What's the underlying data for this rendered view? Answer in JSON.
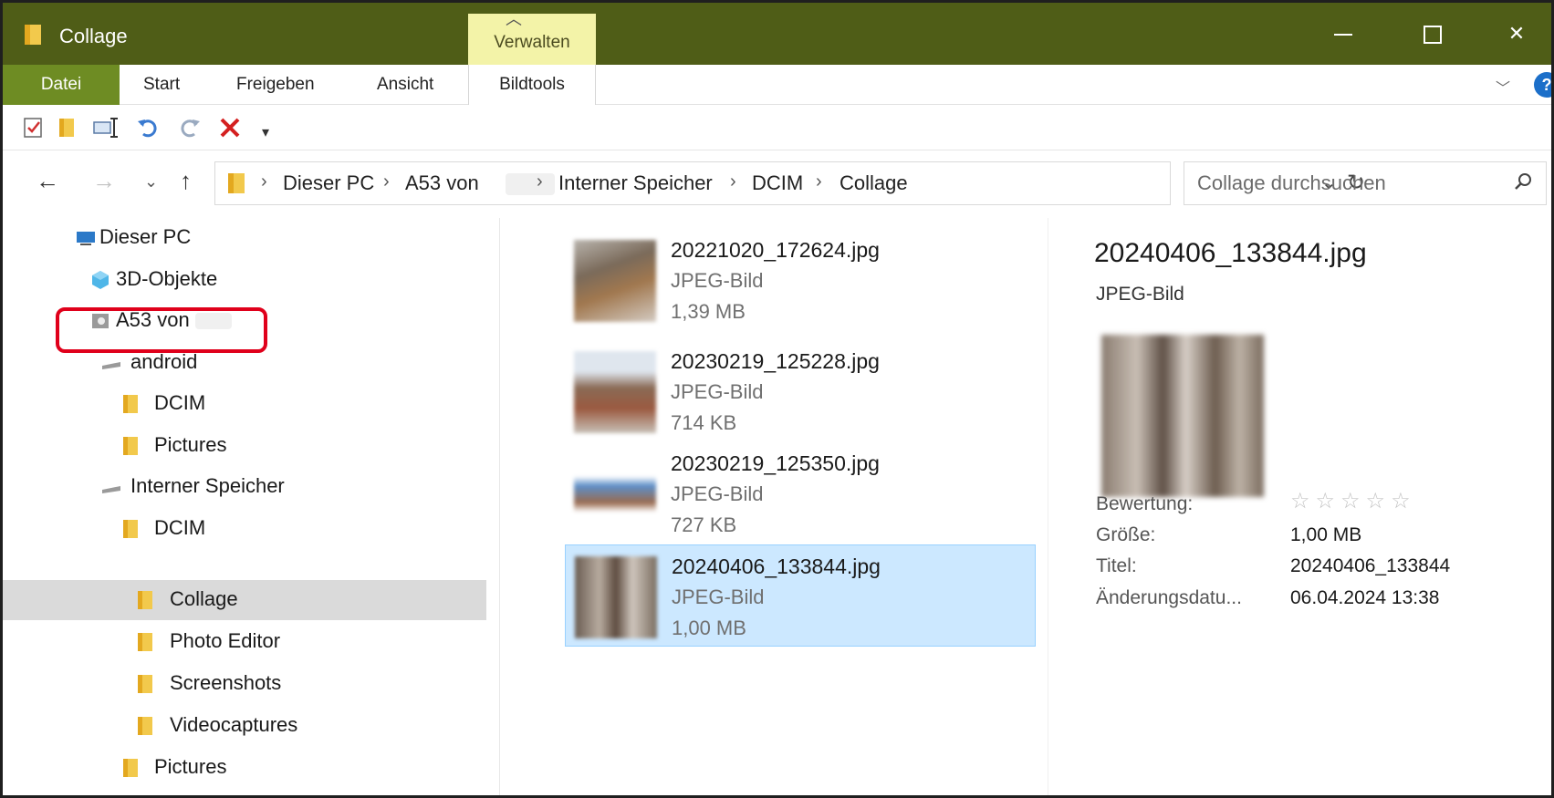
{
  "window": {
    "title": "Collage",
    "tool_tab": "Verwalten"
  },
  "ribbon": {
    "tabs": [
      "Datei",
      "Start",
      "Freigeben",
      "Ansicht",
      "Bildtools"
    ],
    "help": "?"
  },
  "address": {
    "crumbs": [
      "Dieser PC",
      "A53 von",
      "Interner Speicher",
      "DCIM",
      "Collage"
    ]
  },
  "search": {
    "placeholder": "Collage durchsuchen"
  },
  "nav_tree": [
    {
      "label": "Dieser PC",
      "icon": "pc-icon"
    },
    {
      "label": "3D-Objekte",
      "icon": "3d-objects-icon"
    },
    {
      "label": "A53 von",
      "icon": "phone-camera-icon"
    },
    {
      "label": "android",
      "icon": "drive-icon"
    },
    {
      "label": "DCIM",
      "icon": "folder-icon"
    },
    {
      "label": "Pictures",
      "icon": "folder-icon"
    },
    {
      "label": "Interner Speicher",
      "icon": "drive-icon"
    },
    {
      "label": "DCIM",
      "icon": "folder-icon"
    },
    {
      "label": "Collage",
      "icon": "folder-icon"
    },
    {
      "label": "Photo Editor",
      "icon": "folder-icon"
    },
    {
      "label": "Screenshots",
      "icon": "folder-icon"
    },
    {
      "label": "Videocaptures",
      "icon": "folder-icon"
    },
    {
      "label": "Pictures",
      "icon": "folder-icon"
    }
  ],
  "files": [
    {
      "name": "20221020_172624.jpg",
      "type": "JPEG-Bild",
      "size": "1,39 MB"
    },
    {
      "name": "20230219_125228.jpg",
      "type": "JPEG-Bild",
      "size": "714 KB"
    },
    {
      "name": "20230219_125350.jpg",
      "type": "JPEG-Bild",
      "size": "727 KB"
    },
    {
      "name": "20240406_133844.jpg",
      "type": "JPEG-Bild",
      "size": "1,00 MB"
    }
  ],
  "details": {
    "name": "20240406_133844.jpg",
    "type": "JPEG-Bild",
    "labels": {
      "rating": "Bewertung:",
      "size": "Größe:",
      "title": "Titel:",
      "modified": "Änderungsdatu..."
    },
    "values": {
      "rating_stars": 0,
      "size": "1,00 MB",
      "title": "20240406_133844",
      "modified": "06.04.2024 13:38"
    }
  },
  "colors": {
    "titlebar": "#4f5d17",
    "tool_tab": "#f3f3a8",
    "datei_tab": "#6e8c23",
    "selection": "#cce8ff",
    "highlight": "#e0001b"
  }
}
